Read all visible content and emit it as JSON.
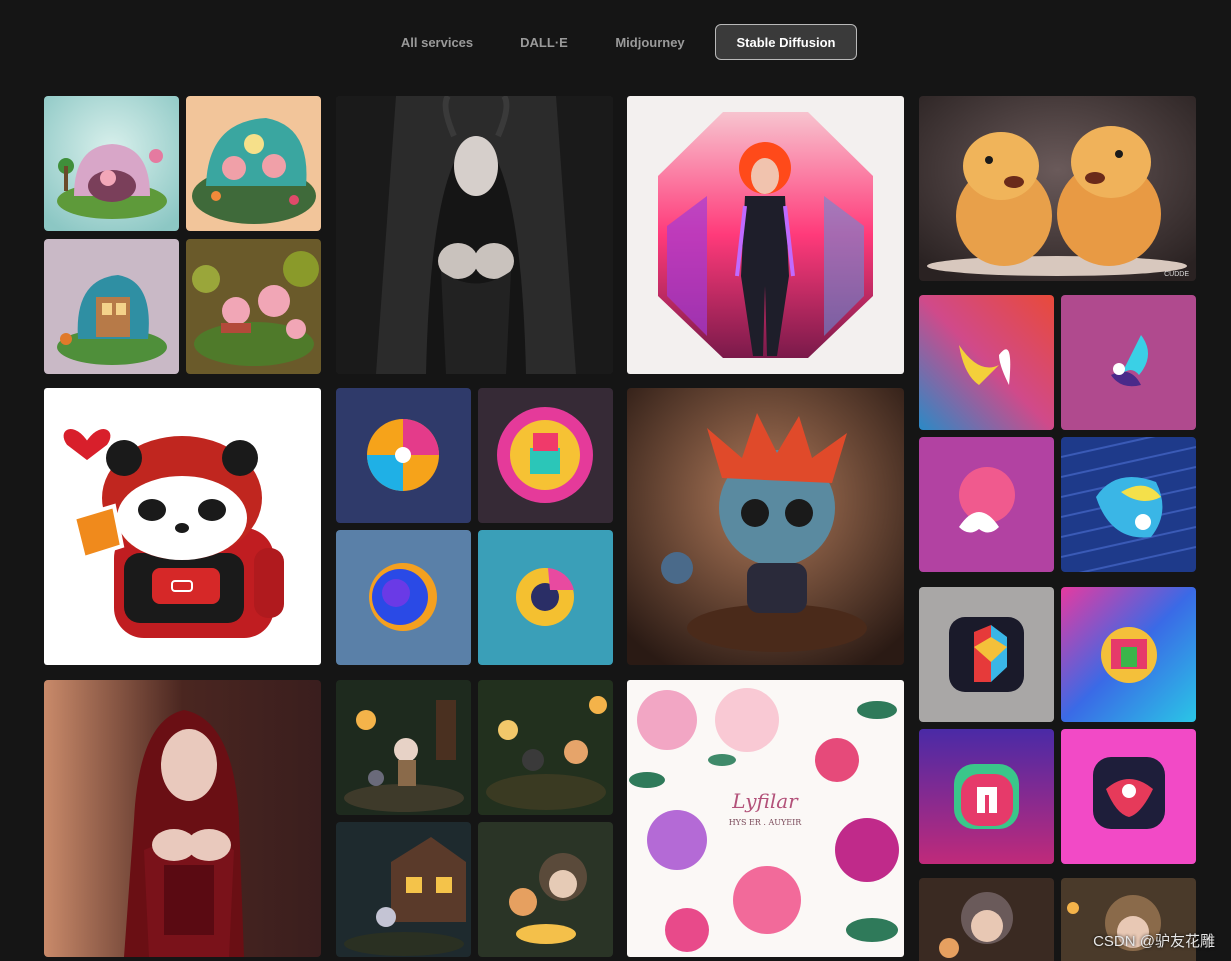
{
  "tabs": [
    {
      "label": "All services",
      "active": false
    },
    {
      "label": "DALL·E",
      "active": false
    },
    {
      "label": "Midjourney",
      "active": false
    },
    {
      "label": "Stable Diffusion",
      "active": true
    }
  ],
  "gallery": {
    "column1": [
      "isometric-house-1",
      "isometric-house-2",
      "isometric-house-3",
      "isometric-house-4",
      "red-panda-sticker",
      "vampire-woman"
    ],
    "column2": [
      "horned-dark-queen",
      "logo-swirl-1",
      "logo-circle-2",
      "logo-ring-3",
      "logo-orbit-4",
      "forest-kitten-1",
      "forest-kitten-2",
      "forest-kitten-3",
      "forest-kitten-4"
    ],
    "column3": [
      "neon-woman-octagon",
      "chibi-creature",
      "floral-card"
    ],
    "column4": [
      "capybaras",
      "icon-bird-1",
      "icon-bird-2",
      "icon-bird-3",
      "icon-bird-4",
      "app-icon-1",
      "app-icon-2",
      "app-icon-3",
      "app-icon-4",
      "girl-kitten-1",
      "girl-kitten-2"
    ]
  },
  "floral_card_text": {
    "line1": "Lyfilar",
    "line2": "HYS ER . AUYEIR"
  },
  "capybara_signature": "CUDDE",
  "watermark": "CSDN @驴友花雕",
  "colors": {
    "background": "#151515",
    "tab_active_bg": "#3a3a3a",
    "tab_inactive_text": "#9a9a9a"
  }
}
